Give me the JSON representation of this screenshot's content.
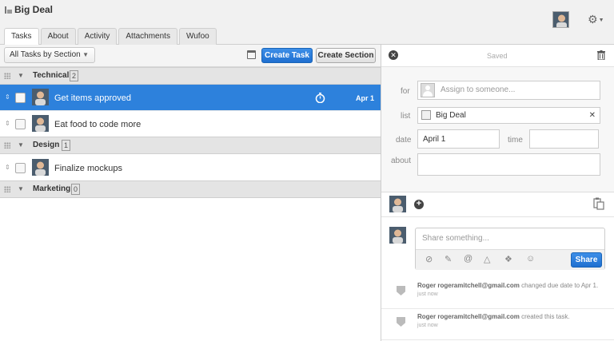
{
  "project": {
    "title": "Big Deal"
  },
  "tabs": [
    {
      "label": "Tasks",
      "active": true
    },
    {
      "label": "About"
    },
    {
      "label": "Activity"
    },
    {
      "label": "Attachments"
    },
    {
      "label": "Wufoo"
    }
  ],
  "toolbar": {
    "filter_label": "All Tasks by Section",
    "create_task": "Create Task",
    "create_section": "Create Section"
  },
  "sections": [
    {
      "name": "Technical",
      "count": "2"
    },
    {
      "name": "Design",
      "count": "1"
    },
    {
      "name": "Marketing",
      "count": "0"
    }
  ],
  "tasks": [
    {
      "name": "Get items approved",
      "due": "Apr 1",
      "selected": true
    },
    {
      "name": "Eat food to code more",
      "due": ""
    },
    {
      "name": "Finalize mockups",
      "due": ""
    }
  ],
  "detail": {
    "saved": "Saved",
    "labels": {
      "for": "for",
      "list": "list",
      "date": "date",
      "time": "time",
      "about": "about"
    },
    "assign_placeholder": "Assign to someone...",
    "list_value": "Big Deal",
    "date_value": "April 1",
    "time_value": "",
    "about_value": "",
    "share_placeholder": "Share something...",
    "share_button": "Share"
  },
  "activity": [
    {
      "user": "Roger",
      "email": "rogeramitchell@gmail.com",
      "text": "changed due date to Apr 1.",
      "when": "just now"
    },
    {
      "user": "Roger",
      "email": "rogeramitchell@gmail.com",
      "text": "created this task.",
      "when": "just now"
    }
  ],
  "colors": {
    "accent": "#2d81dc",
    "button_blue": "#1f6fd0"
  }
}
